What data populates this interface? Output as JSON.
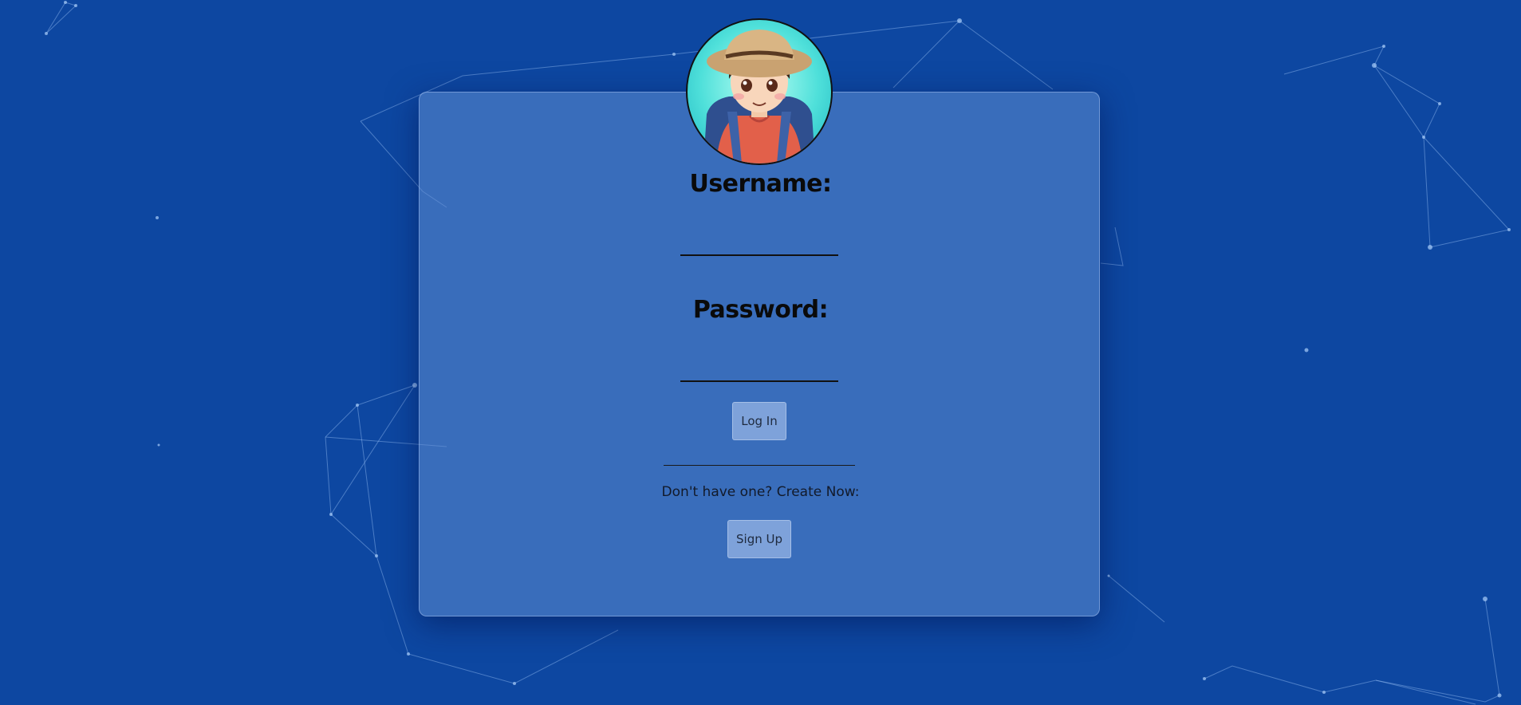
{
  "login_form": {
    "username_label": "Username:",
    "username_value": "",
    "password_label": "Password:",
    "password_value": "",
    "login_button_label": "Log In"
  },
  "signup": {
    "prompt_text": "Don't have one? Create Now:",
    "signup_button_label": "Sign Up"
  },
  "colors": {
    "background": "#0d47a1",
    "card": "#5e8cd2",
    "avatar_ring": "#4fe0da"
  },
  "icons": {
    "avatar": "cartoon-boy-with-hat-avatar"
  }
}
